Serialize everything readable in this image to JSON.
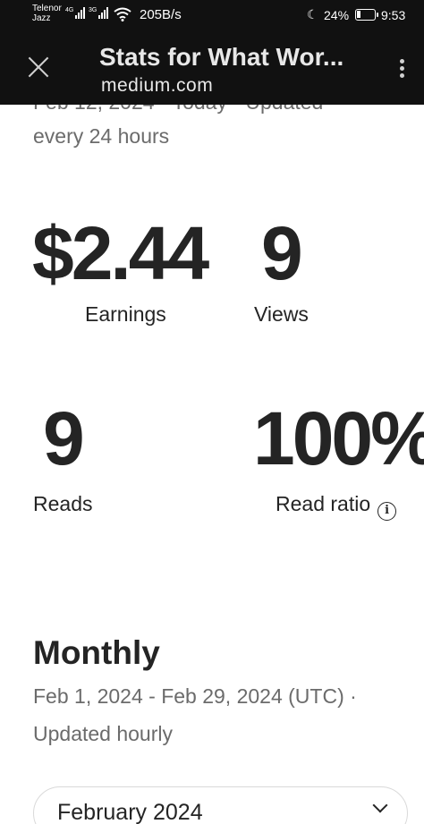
{
  "status_bar": {
    "carrier_1": "Telenor",
    "carrier_2": "Jazz",
    "sig1_label": "4G",
    "sig2_label": "3G",
    "net_speed": "205B/s",
    "battery_pct": "24%",
    "battery_level": 0.24,
    "time": "9:53"
  },
  "toolbar": {
    "title": "Stats for What Wor...",
    "url": "medium.com"
  },
  "story": {
    "partial_line": "Feb 12, 2024 · Today · Updated",
    "update_freq": "every 24 hours"
  },
  "stats": {
    "earnings": {
      "value": "$2.44",
      "label": "Earnings"
    },
    "views": {
      "value": "9",
      "label": "Views"
    },
    "reads": {
      "value": "9",
      "label": "Reads"
    },
    "read_ratio": {
      "value": "100%",
      "label": "Read ratio"
    }
  },
  "monthly": {
    "title": "Monthly",
    "date_range": "Feb 1, 2024 - Feb 29, 2024 (UTC)  ·",
    "update_note": "Updated hourly",
    "selected_month": "February 2024"
  },
  "icons": {
    "close": "close-icon",
    "menu": "more-vert-icon",
    "info": "info-icon",
    "dropdown": "chevron-down-icon",
    "info_glyph": "i"
  },
  "colors": {
    "toolbar_bg": "#111111",
    "text_primary": "#242424",
    "text_secondary": "#6b6b6b"
  }
}
